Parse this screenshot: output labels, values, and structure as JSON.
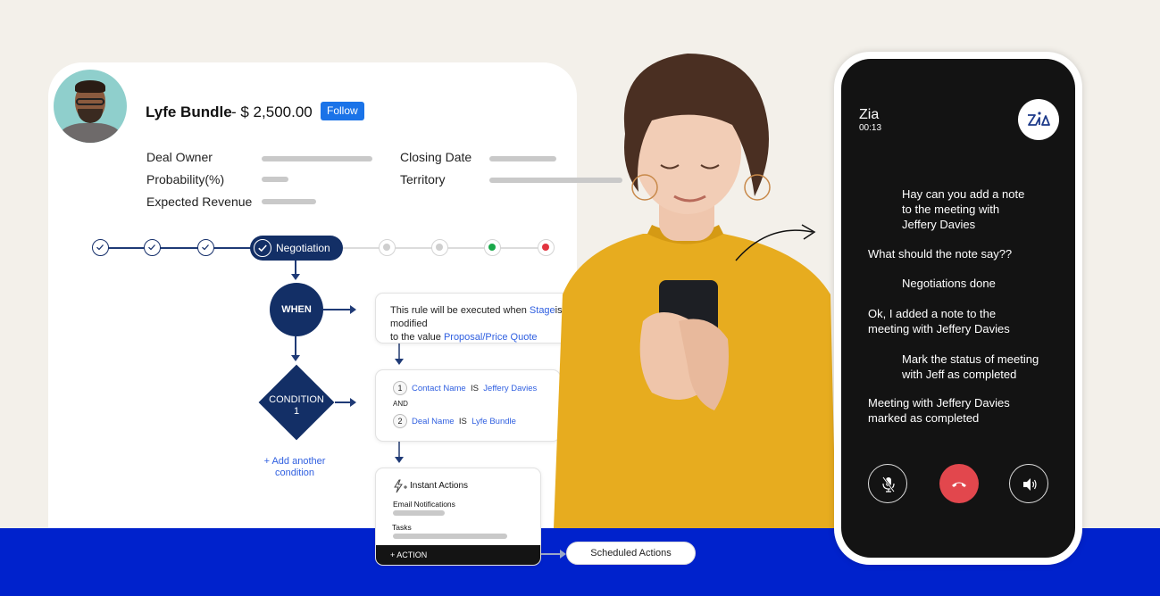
{
  "deal": {
    "title": "Lyfe Bundle",
    "amount": "- $ 2,500.00",
    "follow_label": "Follow"
  },
  "fields": {
    "deal_owner": "Deal Owner",
    "probability": "Probability(%)",
    "expected_revenue": "Expected Revenue",
    "closing_date": "Closing Date",
    "territory": "Territory"
  },
  "pipeline": {
    "current_stage": "Negotiation",
    "completed_count": 3,
    "pending_colors": [
      "#cfcfcf",
      "#cfcfcf",
      "#1aa84a",
      "#e2343f"
    ]
  },
  "workflow": {
    "when_label": "WHEN",
    "when_text_1": "This rule will be executed when ",
    "when_field": "Stage",
    "when_text_2": "is modified",
    "when_text_3": "to the value ",
    "when_value": "Proposal/Price Quote",
    "condition_label": "CONDITION",
    "condition_number": "1",
    "conditions": [
      {
        "num": "1",
        "field": "Contact Name",
        "op": "IS",
        "value": "Jeffery Davies"
      },
      {
        "num": "2",
        "field": "Deal Name",
        "op": "IS",
        "value": "Lyfe Bundle"
      }
    ],
    "and_label": "AND",
    "add_condition_line1": "+ Add another",
    "add_condition_line2": "condition",
    "instant_actions_label": "Instant Actions",
    "email_notifications_label": "Email Notifications",
    "tasks_label": "Tasks",
    "add_action_label": "+ ACTION",
    "scheduled_actions_label": "Scheduled Actions"
  },
  "call": {
    "caller": "Zia",
    "duration": "00:13",
    "messages": [
      {
        "from": "user",
        "lines": [
          "Hay can you add a note",
          "to the meeting with",
          "Jeffery Davies"
        ]
      },
      {
        "from": "bot",
        "lines": [
          "What should the note say??"
        ]
      },
      {
        "from": "user",
        "lines": [
          "Negotiations done"
        ]
      },
      {
        "from": "bot",
        "lines": [
          "Ok, I added a note to the",
          "meeting with Jeffery Davies"
        ]
      },
      {
        "from": "user",
        "lines": [
          "Mark the status of meeting",
          "with Jeff as completed"
        ]
      },
      {
        "from": "bot",
        "lines": [
          "Meeting with Jeffery Davies",
          "marked as completed"
        ]
      }
    ],
    "controls": [
      "mute-mic-icon",
      "end-call-icon",
      "speaker-icon"
    ],
    "end_call_color": "#e2474d"
  },
  "colors": {
    "background": "#f3f0ea",
    "brand_blue": "#0022cc",
    "navy": "#132f66",
    "link": "#2f5fe0",
    "follow": "#1a73e8"
  }
}
